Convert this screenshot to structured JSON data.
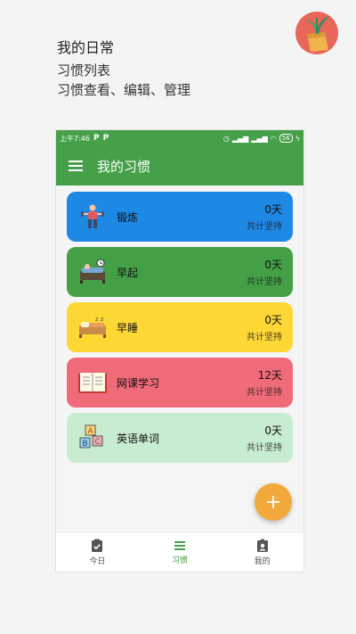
{
  "promo": {
    "title": "我的日常",
    "line1": "习惯列表",
    "line2": "习惯查看、编辑、管理"
  },
  "status_bar": {
    "time": "上午7:46",
    "battery": "56"
  },
  "app_bar": {
    "title": "我的习惯"
  },
  "habits": [
    {
      "name": "锻炼",
      "days": "0天",
      "label": "共计坚持",
      "color": "#1e88e5",
      "icon": "exercise-icon"
    },
    {
      "name": "早起",
      "days": "0天",
      "label": "共计坚持",
      "color": "#43a047",
      "icon": "alarm-bed-icon"
    },
    {
      "name": "早睡",
      "days": "0天",
      "label": "共计坚持",
      "color": "#fdd835",
      "icon": "sleep-bed-icon"
    },
    {
      "name": "网课学习",
      "days": "12天",
      "label": "共计坚持",
      "color": "#f06b7a",
      "icon": "book-icon"
    },
    {
      "name": "英语单词",
      "days": "0天",
      "label": "共计坚持",
      "color": "#c8ecd0",
      "icon": "abc-blocks-icon"
    }
  ],
  "fab": {
    "symbol": "+"
  },
  "bottom_nav": [
    {
      "label": "今日",
      "icon": "clipboard-check-icon",
      "active": false
    },
    {
      "label": "习惯",
      "icon": "list-icon",
      "active": true
    },
    {
      "label": "我的",
      "icon": "profile-badge-icon",
      "active": false
    }
  ]
}
